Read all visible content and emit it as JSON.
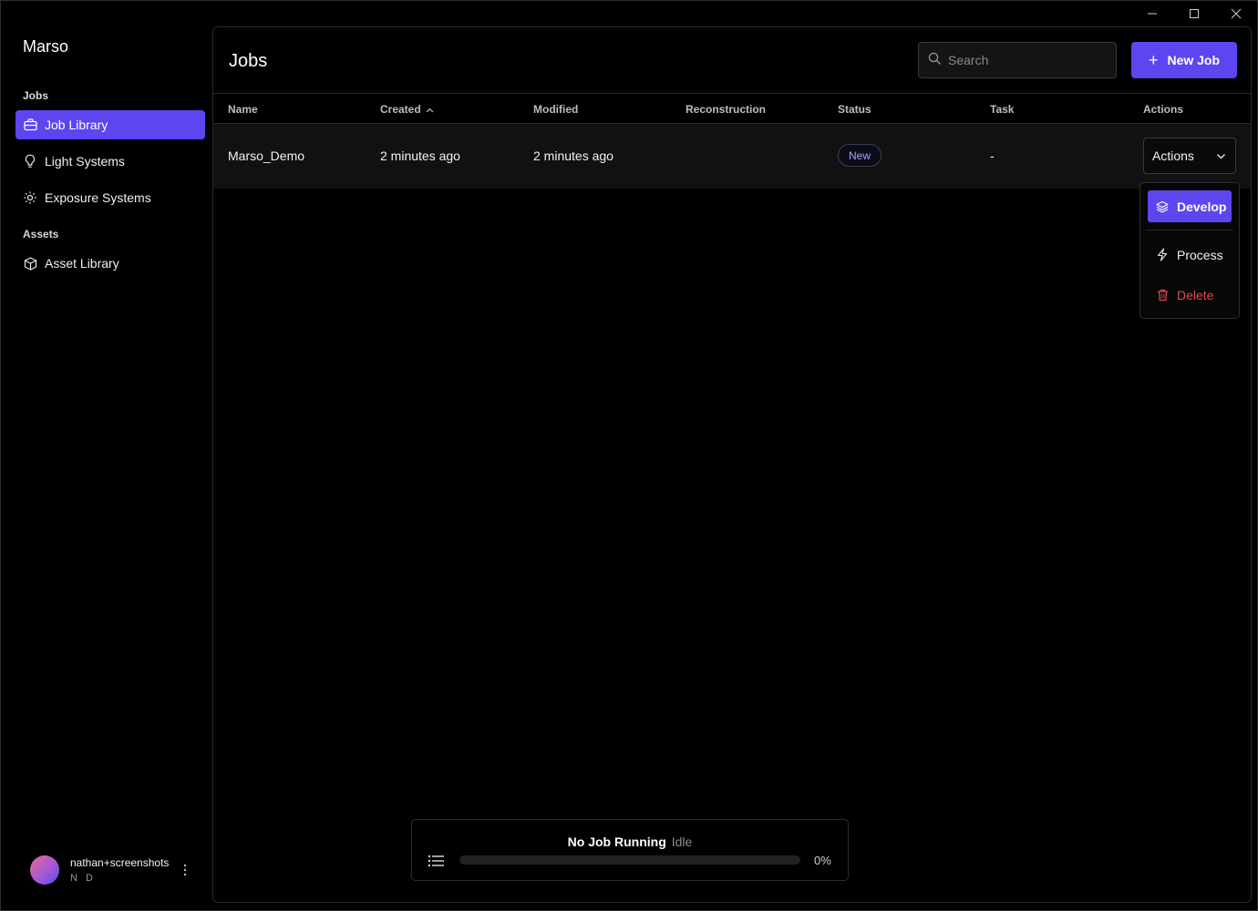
{
  "window_controls": {
    "minimize": "minimize-icon",
    "maximize": "maximize-icon",
    "close": "close-icon"
  },
  "app": {
    "name": "Marso"
  },
  "sidebar": {
    "sections": [
      {
        "label": "Jobs",
        "items": [
          {
            "label": "Job Library",
            "icon": "briefcase-icon",
            "active": true
          },
          {
            "label": "Light Systems",
            "icon": "lightbulb-icon",
            "active": false
          },
          {
            "label": "Exposure Systems",
            "icon": "sun-icon",
            "active": false
          }
        ]
      },
      {
        "label": "Assets",
        "items": [
          {
            "label": "Asset Library",
            "icon": "box-icon",
            "active": false
          }
        ]
      }
    ],
    "user": {
      "name": "nathan+screenshots",
      "initials": "N D"
    }
  },
  "header": {
    "title": "Jobs",
    "search": {
      "placeholder": "Search",
      "value": ""
    },
    "new_job_label": "New Job"
  },
  "table": {
    "columns": [
      "Name",
      "Created",
      "Modified",
      "Reconstruction",
      "Status",
      "Task",
      "Actions"
    ],
    "sort": {
      "column": "Created",
      "direction": "asc"
    },
    "rows": [
      {
        "name": "Marso_Demo",
        "created": "2 minutes ago",
        "modified": "2 minutes ago",
        "reconstruction": "",
        "status": "New",
        "task": "-",
        "actions_label": "Actions"
      }
    ]
  },
  "actions_menu": {
    "items": [
      {
        "label": "Develop",
        "icon": "layers-icon"
      },
      {
        "label": "Process",
        "icon": "lightning-icon"
      },
      {
        "label": "Delete",
        "icon": "trash-icon"
      }
    ]
  },
  "status_bar": {
    "job": "No Job Running",
    "state": "Idle",
    "progress_percent": 0,
    "progress_label": "0%"
  },
  "colors": {
    "accent": "#5b46f0",
    "danger": "#e5484d",
    "background": "#000000"
  }
}
